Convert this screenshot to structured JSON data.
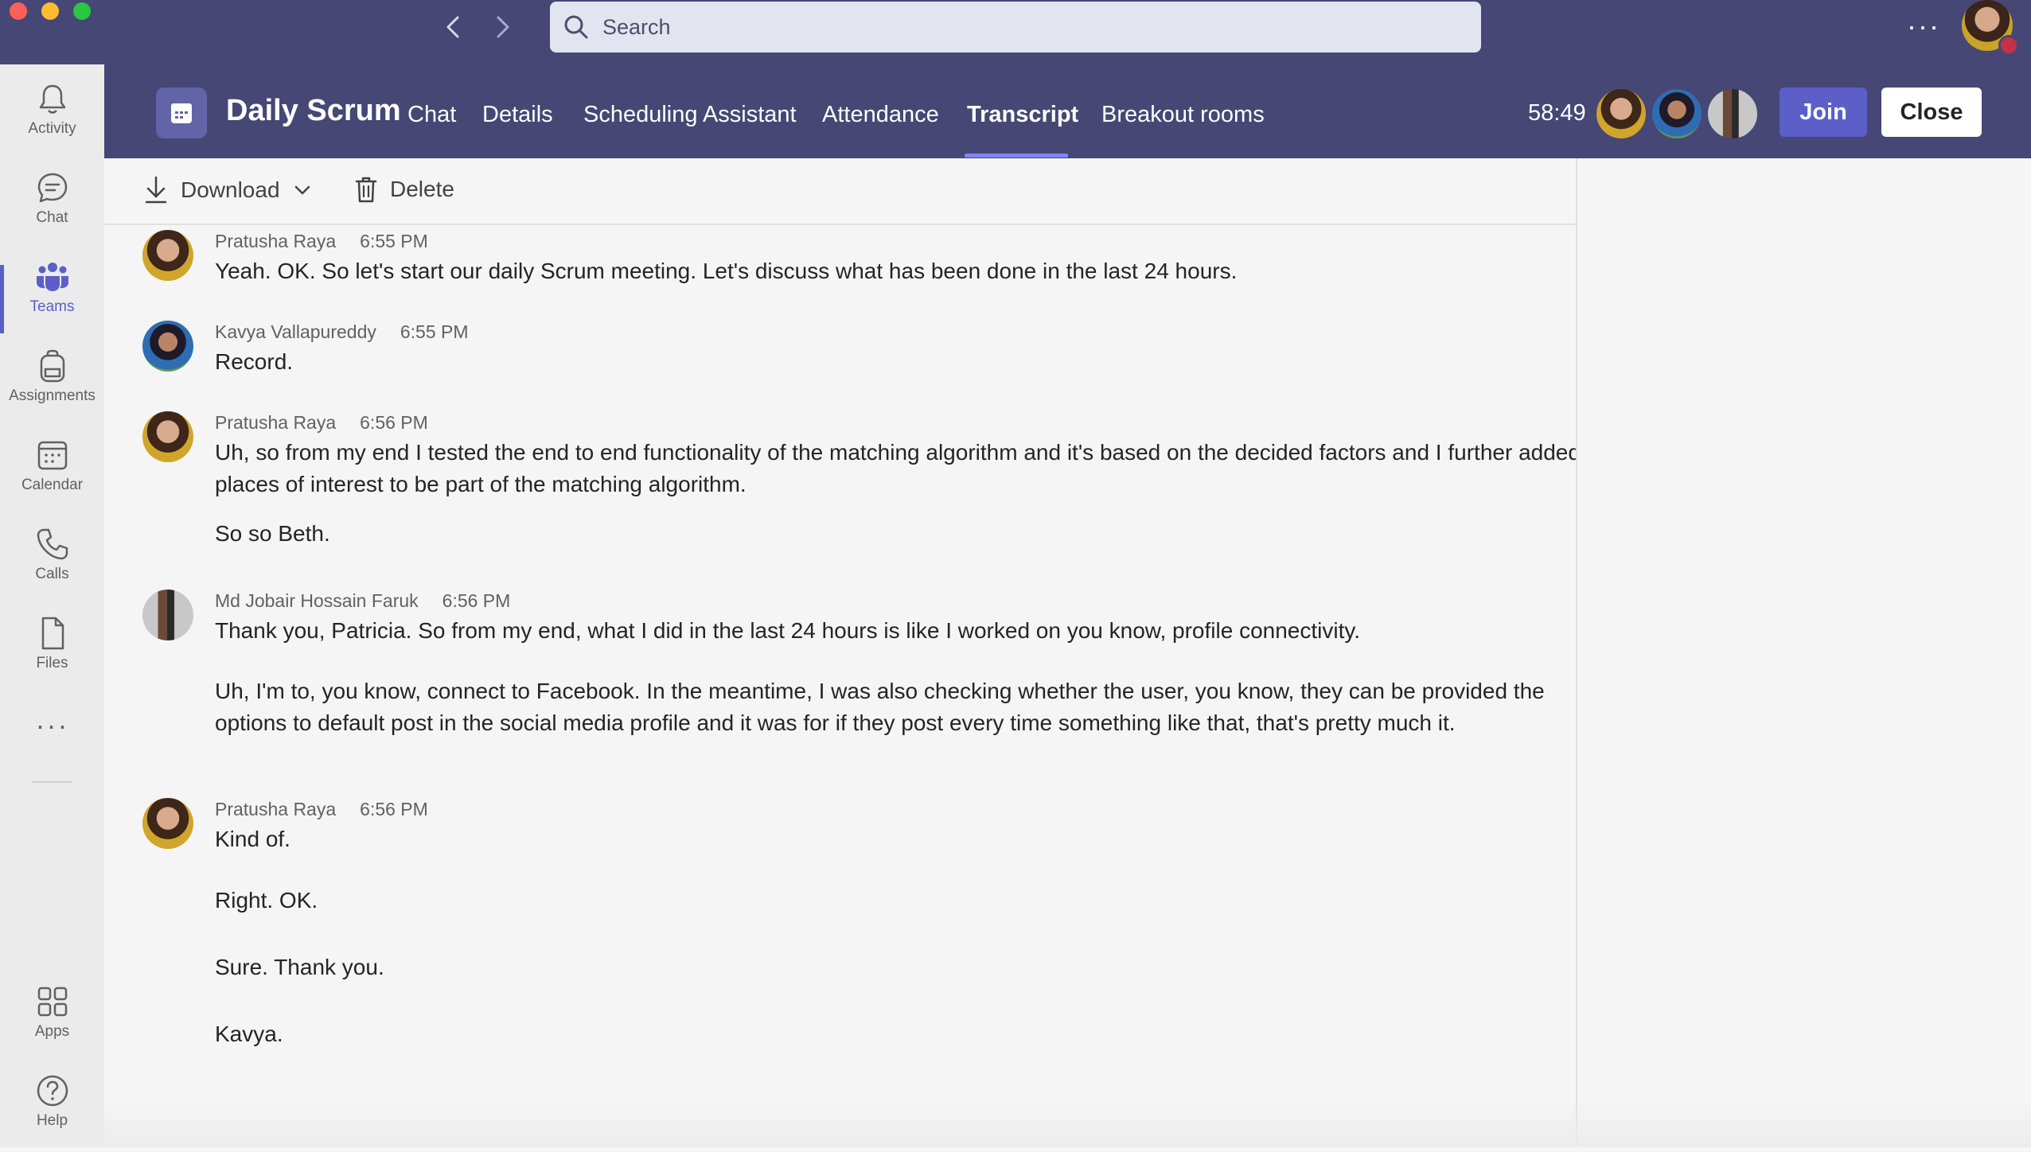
{
  "window": {
    "search": {
      "placeholder": "Search"
    }
  },
  "rail": {
    "items": [
      {
        "label": "Activity",
        "icon": "bell-icon"
      },
      {
        "label": "Chat",
        "icon": "chat-icon"
      },
      {
        "label": "Teams",
        "icon": "teams-icon",
        "active": true
      },
      {
        "label": "Assignments",
        "icon": "backpack-icon"
      },
      {
        "label": "Calendar",
        "icon": "calendar-icon"
      },
      {
        "label": "Calls",
        "icon": "phone-icon"
      },
      {
        "label": "Files",
        "icon": "file-icon"
      }
    ],
    "more": "···",
    "bottom": [
      {
        "label": "Apps",
        "icon": "apps-icon"
      },
      {
        "label": "Help",
        "icon": "help-icon"
      }
    ]
  },
  "meeting": {
    "title": "Daily Scrum",
    "tabs": [
      "Chat",
      "Details",
      "Scheduling Assistant",
      "Attendance",
      "Transcript",
      "Breakout rooms"
    ],
    "active_tab": "Transcript",
    "timer": "58:49",
    "join_label": "Join",
    "close_label": "Close"
  },
  "toolbar": {
    "download_label": "Download",
    "delete_label": "Delete"
  },
  "transcript": [
    {
      "speaker": "Pratusha Raya",
      "time": "6:55 PM",
      "lines": [
        "Yeah. OK. So let's start our daily Scrum meeting. Let's discuss what has been done in the last 24 hours."
      ]
    },
    {
      "speaker": "Kavya Vallapureddy",
      "time": "6:55 PM",
      "lines": [
        "Record."
      ]
    },
    {
      "speaker": "Pratusha Raya",
      "time": "6:56 PM",
      "lines": [
        "Uh, so from my end I tested the end to end functionality of the matching algorithm and it's based on the decided factors and I further added places of interest to be part of the matching algorithm.",
        "So so Beth."
      ]
    },
    {
      "speaker": "Md Jobair Hossain Faruk",
      "time": "6:56 PM",
      "lines": [
        "Thank you, Patricia. So from my end, what I did in the last 24 hours is like I worked on you know, profile connectivity.",
        "Uh, I'm to, you know, connect to Facebook. In the meantime, I was also checking whether the user, you know, they can be provided the options to default post in the social media profile and it was for if they post every time something like that, that's pretty much it."
      ]
    },
    {
      "speaker": "Pratusha Raya",
      "time": "6:56 PM",
      "lines": [
        "Kind of.",
        "Right. OK.",
        "Sure. Thank you.",
        "Kavya."
      ]
    }
  ],
  "colors": {
    "titlebar": "#464775",
    "accent": "#5b5fc7",
    "rail_bg": "#ebebeb",
    "content_bg": "#f5f5f5"
  }
}
